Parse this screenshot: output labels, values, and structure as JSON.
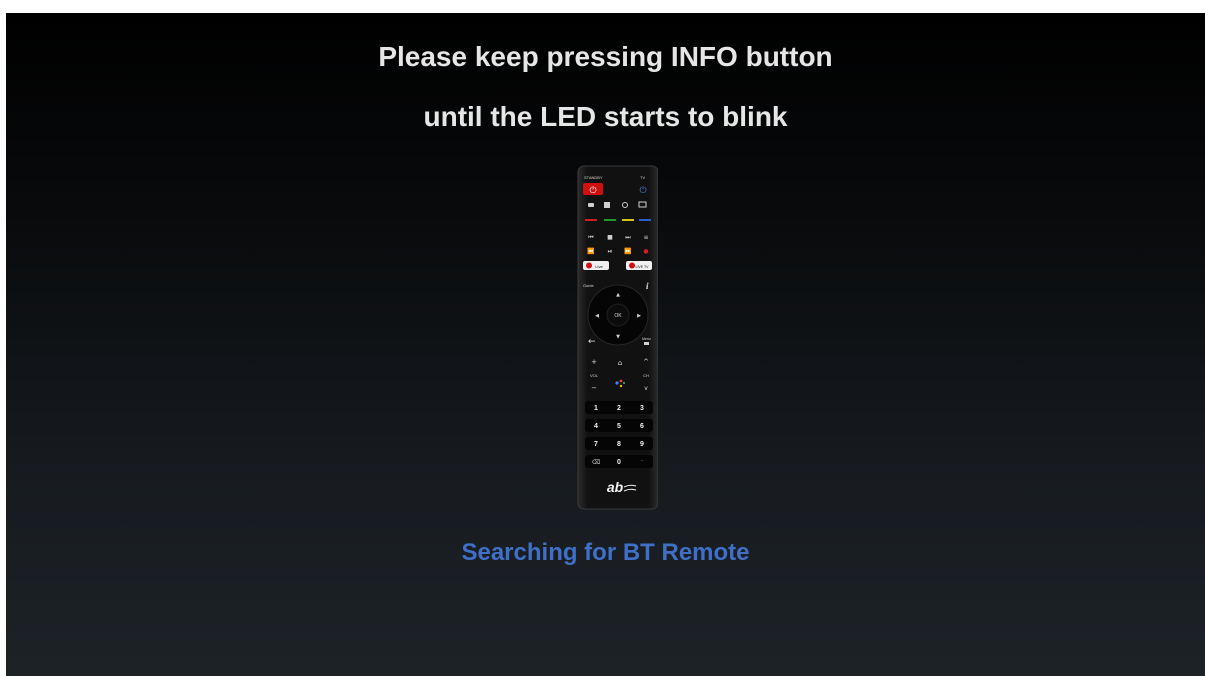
{
  "prompt": {
    "line1": "Please keep pressing INFO button",
    "line2": "until the LED starts to blink"
  },
  "status": {
    "text": "Searching for BT Remote",
    "color": "#3f6fc6"
  },
  "remote": {
    "labels": {
      "standby": "STANDBY",
      "tv": "TV",
      "live": "Live",
      "live_tv": "LIVE TV",
      "guide": "Guide",
      "ok": "OK",
      "vol": "VOL",
      "ch": "CH",
      "menu": "Menu",
      "brand": "ab"
    },
    "keypad": [
      "1",
      "2",
      "3",
      "4",
      "5",
      "6",
      "7",
      "8",
      "9",
      "0"
    ],
    "colors": {
      "standby_button": "#d01010",
      "red": "#d01f1f",
      "green": "#1f9a2e",
      "yellow": "#d8c21a",
      "blue": "#2a5fc8"
    }
  }
}
